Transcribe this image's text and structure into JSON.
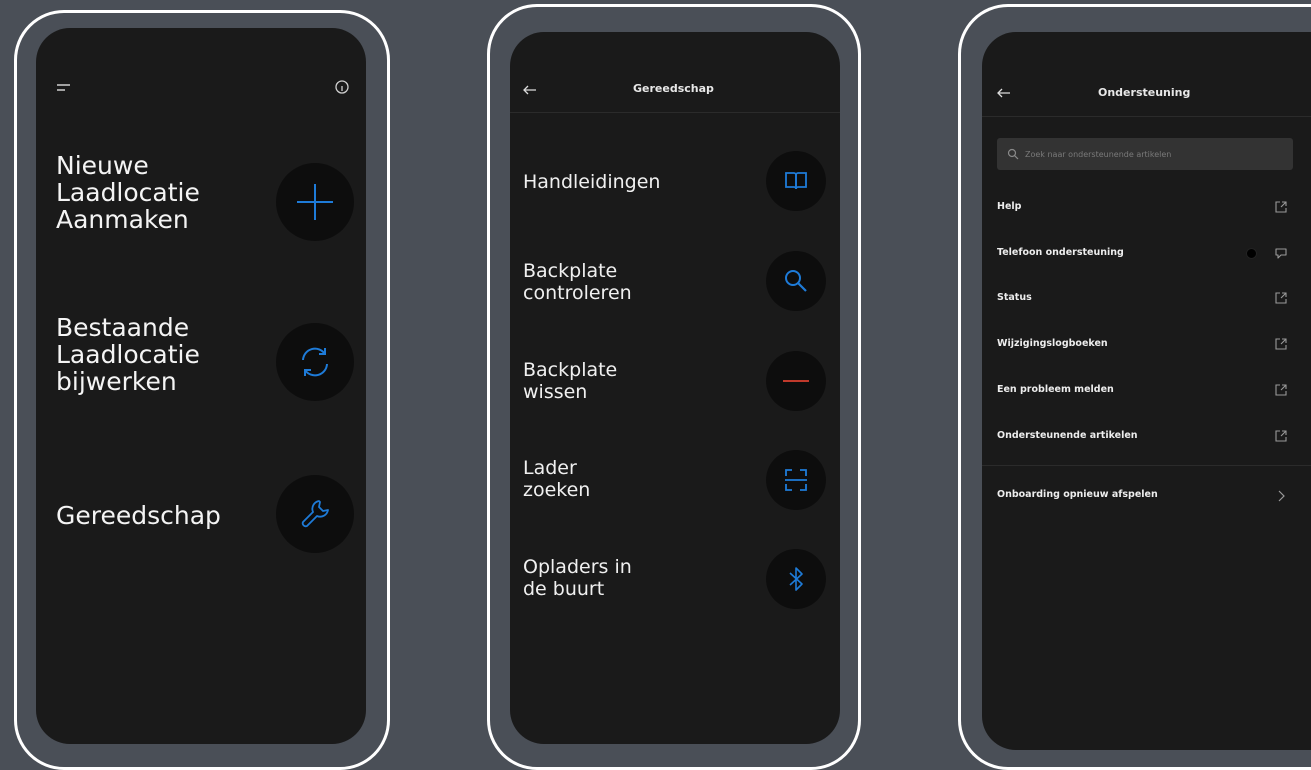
{
  "colors": {
    "background": "#4a4f57",
    "screen": "#1a1a1a",
    "icon_circle": "#0d0d0d",
    "accent_blue": "#1e7bd8",
    "accent_red": "#c0392b",
    "frame": "#ffffff"
  },
  "screen1": {
    "menu_icon": "menu-icon",
    "info_icon": "info-icon",
    "actions": [
      {
        "label": "Nieuwe\nLaadlocatie\nAanmaken",
        "icon": "plus-icon"
      },
      {
        "label": "Bestaande\nLaadlocatie\nbijwerken",
        "icon": "refresh-icon"
      },
      {
        "label": "Gereedschap",
        "icon": "wrench-icon"
      }
    ]
  },
  "screen2": {
    "header_title": "Gereedschap",
    "back_icon": "back-arrow-icon",
    "tools": [
      {
        "label": "Handleidingen",
        "icon": "book-icon"
      },
      {
        "label": "Backplate\ncontroleren",
        "icon": "search-icon"
      },
      {
        "label": "Backplate\nwissen",
        "icon": "minus-icon"
      },
      {
        "label": "Lader\nzoeken",
        "icon": "scan-icon"
      },
      {
        "label": "Opladers in\nde buurt",
        "icon": "bluetooth-icon"
      }
    ]
  },
  "screen3": {
    "header_title": "Ondersteuning",
    "back_icon": "back-arrow-icon",
    "search_placeholder": "Zoek naar ondersteunende artikelen",
    "rows": [
      {
        "label": "Help",
        "icon": "external-link-icon"
      },
      {
        "label": "Telefoon ondersteuning",
        "icon": "chat-icon"
      },
      {
        "label": "Status",
        "icon": "external-link-icon"
      },
      {
        "label": "Wijzigingslogboeken",
        "icon": "external-link-icon"
      },
      {
        "label": "Een probleem melden",
        "icon": "external-link-icon"
      },
      {
        "label": "Ondersteunende artikelen",
        "icon": "external-link-icon"
      }
    ],
    "onboarding_label": "Onboarding opnieuw afspelen",
    "onboarding_icon": "chevron-right-icon"
  }
}
